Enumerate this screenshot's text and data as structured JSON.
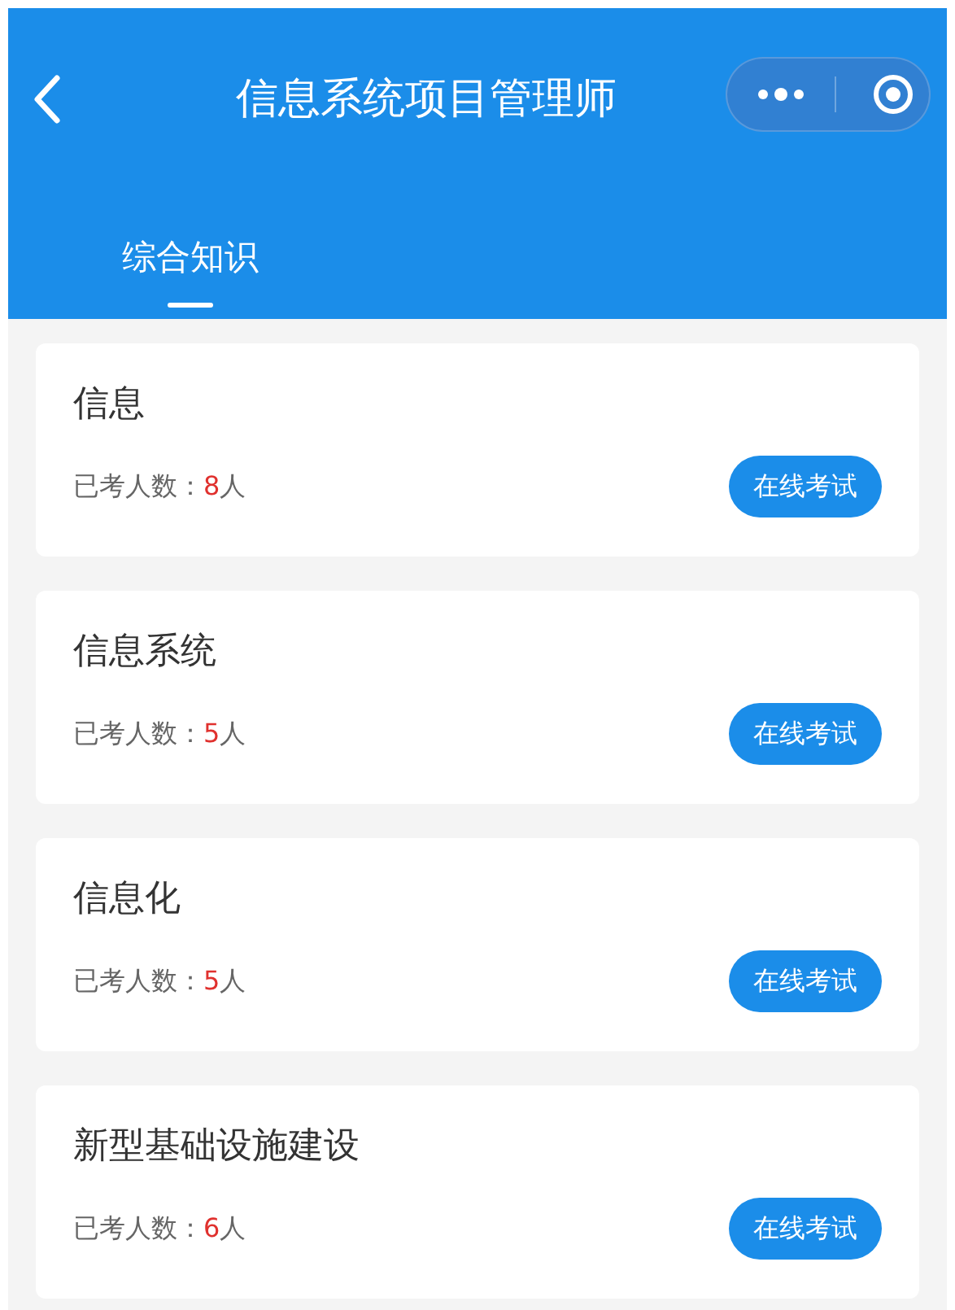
{
  "header": {
    "title": "信息系统项目管理师"
  },
  "tabs": [
    {
      "label": "综合知识",
      "selected": true
    }
  ],
  "items": [
    {
      "title": "信息",
      "label": "已考人数：",
      "count": "8",
      "unit": "人",
      "button": "在线考试"
    },
    {
      "title": "信息系统",
      "label": "已考人数：",
      "count": "5",
      "unit": "人",
      "button": "在线考试"
    },
    {
      "title": "信息化",
      "label": "已考人数：",
      "count": "5",
      "unit": "人",
      "button": "在线考试"
    },
    {
      "title": "新型基础设施建设",
      "label": "已考人数：",
      "count": "6",
      "unit": "人",
      "button": "在线考试"
    }
  ]
}
